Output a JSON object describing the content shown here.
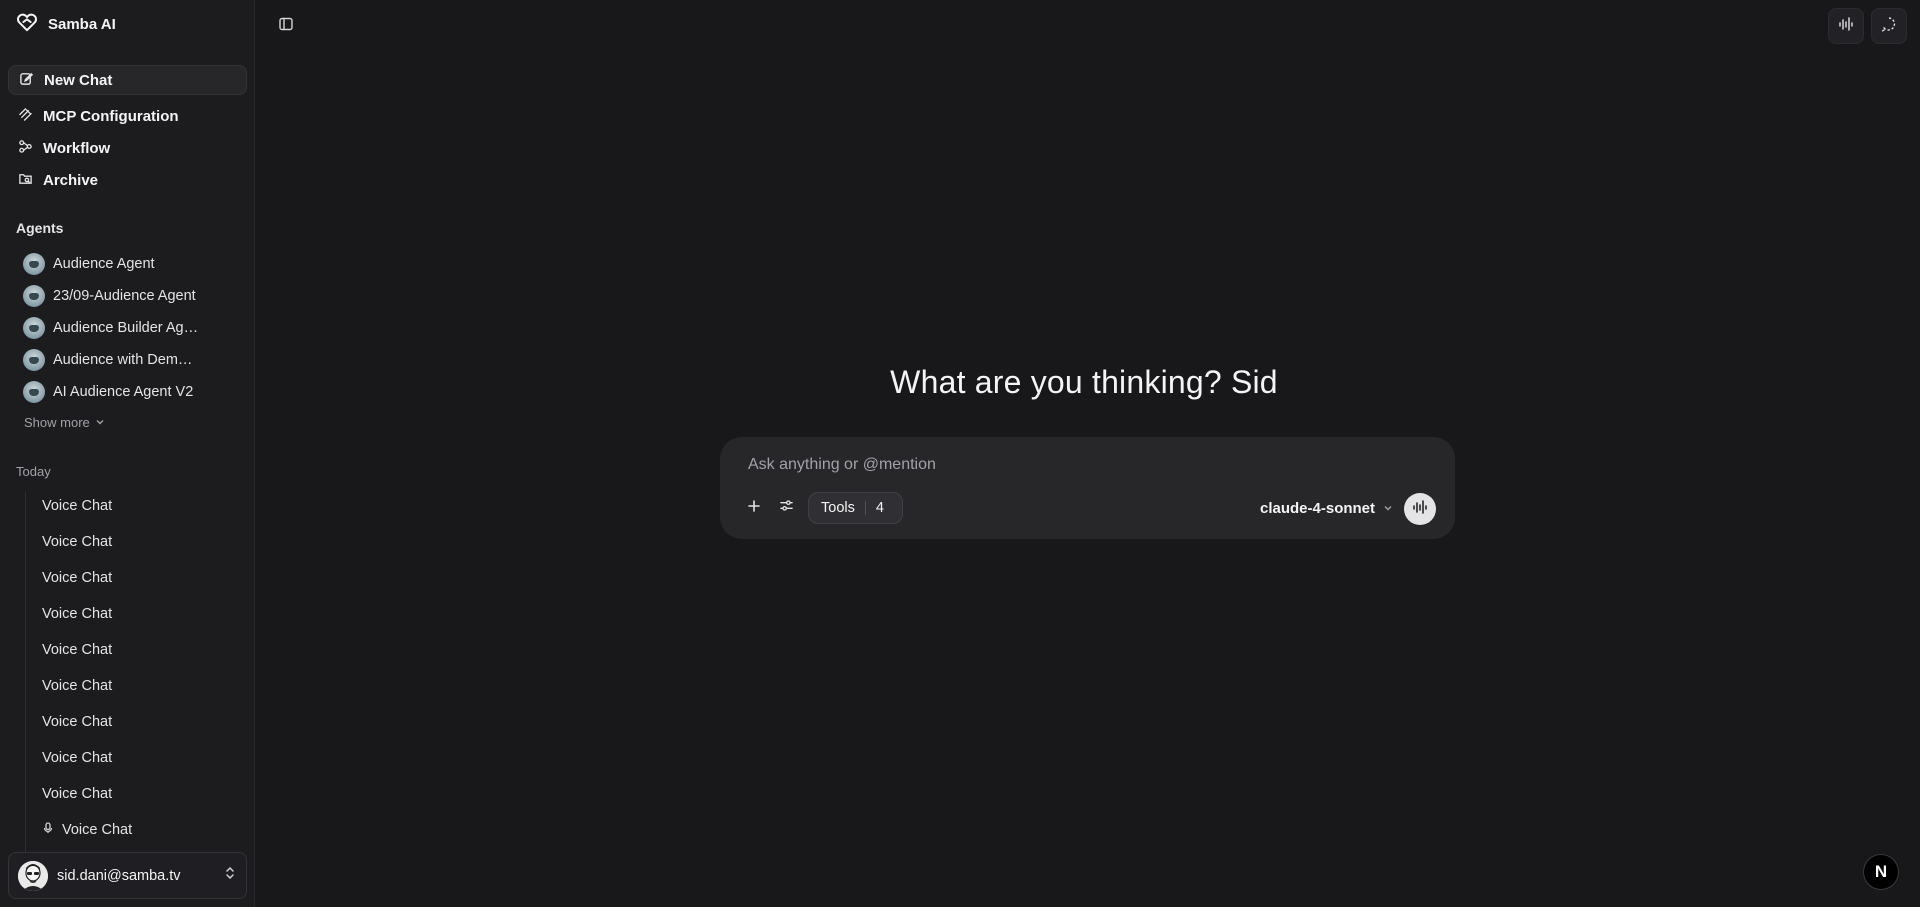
{
  "brand": {
    "name": "Samba AI"
  },
  "nav": [
    {
      "label": "New Chat",
      "icon": "edit-icon"
    },
    {
      "label": "MCP Configuration",
      "icon": "mcp-icon"
    },
    {
      "label": "Workflow",
      "icon": "workflow-icon"
    },
    {
      "label": "Archive",
      "icon": "archive-icon"
    }
  ],
  "agents": {
    "title": "Agents",
    "items": [
      {
        "label": "Audience Agent"
      },
      {
        "label": "23/09-Audience Agent"
      },
      {
        "label": "Audience Builder Agent"
      },
      {
        "label": "Audience with Demographics"
      },
      {
        "label": "AI Audience Agent V2"
      }
    ],
    "show_more": "Show more"
  },
  "history": {
    "title": "Today",
    "items": [
      {
        "label": "Voice Chat"
      },
      {
        "label": "Voice Chat"
      },
      {
        "label": "Voice Chat"
      },
      {
        "label": "Voice Chat"
      },
      {
        "label": "Voice Chat"
      },
      {
        "label": "Voice Chat"
      },
      {
        "label": "Voice Chat"
      },
      {
        "label": "Voice Chat"
      },
      {
        "label": "Voice Chat"
      },
      {
        "label": "Voice Chat",
        "icon": "mic-icon"
      }
    ]
  },
  "user": {
    "email": "sid.dani@samba.tv"
  },
  "main": {
    "greeting": "What are you thinking? Sid",
    "composer": {
      "placeholder": "Ask anything or @mention",
      "tools_label": "Tools",
      "tools_count": "4",
      "model": "claude-4-sonnet"
    }
  },
  "badge": {
    "label": "N"
  },
  "colors": {
    "background": "#18181b",
    "sidebar": "#1c1c1f",
    "composer": "#27272a",
    "text": "#f4f4f5",
    "muted": "#a1a1aa"
  }
}
